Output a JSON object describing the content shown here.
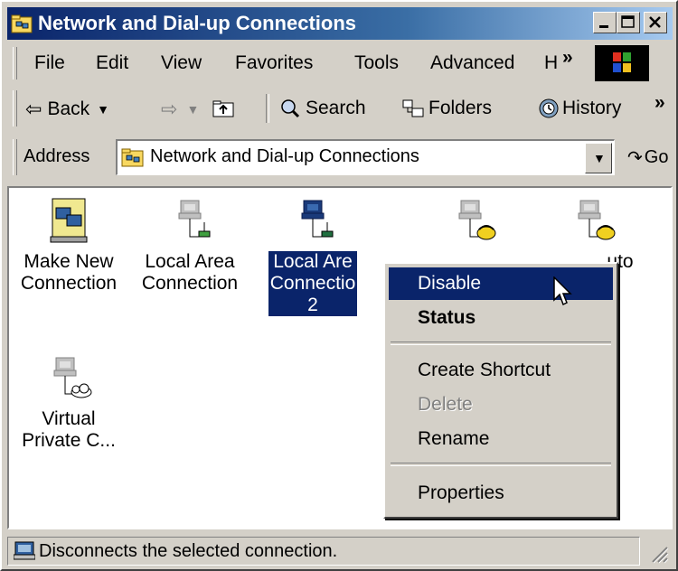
{
  "window": {
    "title": "Network and Dial-up Connections",
    "title_icon": "folder-network-icon",
    "buttons": [
      "minimize-icon",
      "maximize-icon",
      "close-icon"
    ]
  },
  "menu": {
    "items": [
      "File",
      "Edit",
      "View",
      "Favorites",
      "Tools",
      "Advanced",
      "H"
    ],
    "overflow": "»"
  },
  "toolbar": {
    "back": "Back",
    "search": "Search",
    "folders": "Folders",
    "history": "History",
    "overflow": "»"
  },
  "address": {
    "label": "Address",
    "value": "Network and Dial-up Connections",
    "go": "Go"
  },
  "items": [
    {
      "label_lines": [
        "Make New",
        "Connection"
      ],
      "icon": "make-new-connection-icon"
    },
    {
      "label_lines": [
        "Local Area",
        "Connection"
      ],
      "icon": "lan-connection-icon"
    },
    {
      "label_lines": [
        "Local Are",
        "Connectio",
        "2"
      ],
      "icon": "lan-connection-icon",
      "selected": true
    },
    {
      "label_lines": [
        ""
      ],
      "icon": "dialup-connection-icon"
    },
    {
      "label_lines": [
        "uto"
      ],
      "icon": "dialup-connection-icon"
    },
    {
      "label_lines": [
        "Virtual",
        "Private C..."
      ],
      "icon": "vpn-connection-icon"
    }
  ],
  "context_menu": {
    "items": [
      {
        "label": "Disable",
        "highlighted": true
      },
      {
        "label": "Status",
        "bold": true
      },
      {
        "label": "Create Shortcut"
      },
      {
        "label": "Delete",
        "disabled": true
      },
      {
        "label": "Rename"
      },
      {
        "label": "Properties"
      }
    ]
  },
  "status": {
    "text": "Disconnects the selected connection."
  },
  "colors": {
    "face": "#d4d0c8",
    "title_start": "#0a246a",
    "title_end": "#a6caf0",
    "selection": "#0a246a"
  }
}
